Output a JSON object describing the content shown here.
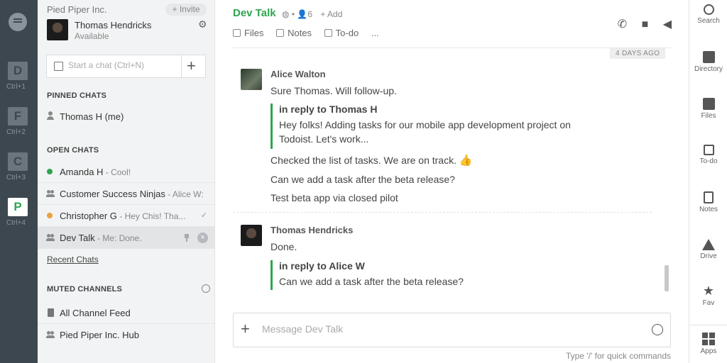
{
  "workspaces": [
    {
      "letter": "D",
      "key": "Ctrl+1"
    },
    {
      "letter": "F",
      "key": "Ctrl+2"
    },
    {
      "letter": "C",
      "key": "Ctrl+3"
    },
    {
      "letter": "P",
      "key": "Ctrl+4"
    }
  ],
  "sidebar": {
    "org": "Pied Piper Inc.",
    "invite": "+ Invite",
    "user_name": "Thomas Hendricks",
    "user_status": "Available",
    "start_chat_placeholder": "Start a chat (Ctrl+N)",
    "pinned_header": "PINNED CHATS",
    "pinned": [
      {
        "name": "Thomas H (me)"
      }
    ],
    "open_header": "OPEN CHATS",
    "open": [
      {
        "name": "Amanda H",
        "preview": " - Cool!"
      },
      {
        "name": "Customer Success Ninjas",
        "preview": " - Alice W:"
      },
      {
        "name": "Christopher G",
        "preview": " - Hey Chis! Tha..."
      },
      {
        "name": "Dev Talk",
        "preview": " - Me: Done."
      }
    ],
    "recent_link": "Recent Chats",
    "muted_header": "MUTED CHANNELS",
    "muted": [
      {
        "name": "All Channel Feed"
      },
      {
        "name": "Pied Piper Inc. Hub"
      }
    ]
  },
  "main": {
    "title": "Dev Talk",
    "member_count": "6",
    "add_label": "+ Add",
    "tabs": [
      "Files",
      "Notes",
      "To-do",
      "..."
    ],
    "date_chip": "4 DAYS AGO",
    "messages": [
      {
        "sender": "Alice Walton",
        "lines": [
          "Sure Thomas. Will follow-up."
        ],
        "quote": {
          "header": "in reply to Thomas H",
          "body": "Hey folks! Adding tasks for our mobile app development project on Todoist. Let's work..."
        },
        "after": [
          "Checked the list of tasks. We are on track.",
          "Can we add a task after the beta release?",
          "Test beta app via closed pilot"
        ]
      },
      {
        "sender": "Thomas Hendricks",
        "lines": [
          "Done."
        ],
        "quote": {
          "header": "in reply to Alice W",
          "body": "Can we add a task after the beta release?"
        }
      }
    ],
    "composer_placeholder": "Message Dev Talk",
    "hint": "Type '/' for quick commands"
  },
  "right_rail": [
    {
      "label": "Search",
      "icon": "search-icon"
    },
    {
      "label": "Directory",
      "icon": "directory-icon"
    },
    {
      "label": "Files",
      "icon": "files-icon"
    },
    {
      "label": "To-do",
      "icon": "todo-icon"
    },
    {
      "label": "Notes",
      "icon": "notes-icon"
    },
    {
      "label": "Drive",
      "icon": "drive-icon"
    },
    {
      "label": "Fav",
      "icon": "star-icon"
    },
    {
      "label": "Apps",
      "icon": "apps-icon"
    }
  ],
  "colors": {
    "accent": "#2ea44f",
    "online": "#2ea44f",
    "away": "#e8a33d",
    "rail": "#3d4750"
  }
}
